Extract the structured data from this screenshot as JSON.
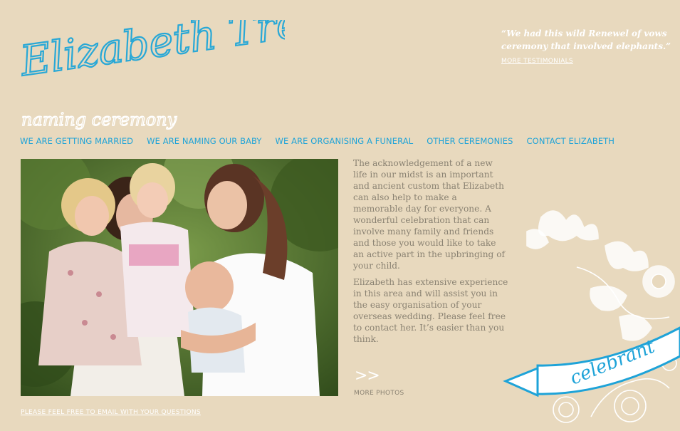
{
  "site": {
    "logo_text": "Elizabeth Trevan",
    "section_title": "naming ceremony"
  },
  "testimonial": {
    "quote": "“We had this wild Renewel of vows ceremony that involved elephants.”",
    "more_link": "MORE TESTIMONIALS"
  },
  "nav": [
    {
      "label": "WE ARE GETTING MARRIED"
    },
    {
      "label": "WE ARE NAMING OUR BABY"
    },
    {
      "label": "WE ARE ORGANISING A FUNERAL"
    },
    {
      "label": "OTHER CEREMONIES"
    },
    {
      "label": "CONTACT ELIZABETH"
    }
  ],
  "content": {
    "paragraph1": "The acknowledgement of a new life in our midst is an important and ancient custom that Elizabeth can also help to make a memorable day for everyone. A wonderful celebration that can involve many family and friends and those you would like to take an active part in the upbringing of your child.",
    "paragraph2": "Elizabeth has extensive experience in this area and will assist you in the easy organisation of your overseas wedding.  Please feel free to contact her.  It’s easier than you think.",
    "more_photos_arrow": ">>",
    "more_photos": "MORE PHOTOS"
  },
  "footer": {
    "email_link": "PLEASE FEEL FREE TO EMAIL WITH YOUR QUESTIONS"
  },
  "decor": {
    "banner_text": "celebrant"
  },
  "colors": {
    "background": "#e8d9be",
    "accent": "#1ea3d8",
    "body_text": "#8a8272",
    "white": "#ffffff"
  }
}
